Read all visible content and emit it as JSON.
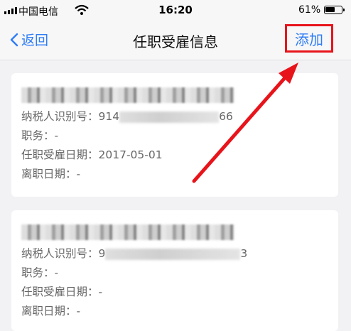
{
  "status_bar": {
    "carrier": "中国电信",
    "time": "16:20",
    "battery_pct": "61%",
    "battery_level": 0.61
  },
  "nav": {
    "back_label": "返回",
    "title": "任职受雇信息",
    "add_label": "添加"
  },
  "cards": [
    {
      "company": "",
      "tax_id_label": "纳税人识别号：",
      "tax_id_prefix": "914",
      "tax_id_suffix": "66",
      "position_label": "职务：",
      "position_value": "-",
      "hire_date_label": "任职受雇日期：",
      "hire_date_value": "2017-05-01",
      "leave_date_label": "离职日期：",
      "leave_date_value": "-"
    },
    {
      "company": "",
      "tax_id_label": "纳税人识别号：",
      "tax_id_prefix": "9",
      "tax_id_suffix": "3",
      "position_label": "职务：",
      "position_value": "-",
      "hire_date_label": "任职受雇日期：",
      "hire_date_value": "-",
      "leave_date_label": "离职日期：",
      "leave_date_value": "-"
    }
  ],
  "colors": {
    "accent": "#2f7df6",
    "highlight": "#e8141b",
    "background": "#f2f2f5"
  }
}
